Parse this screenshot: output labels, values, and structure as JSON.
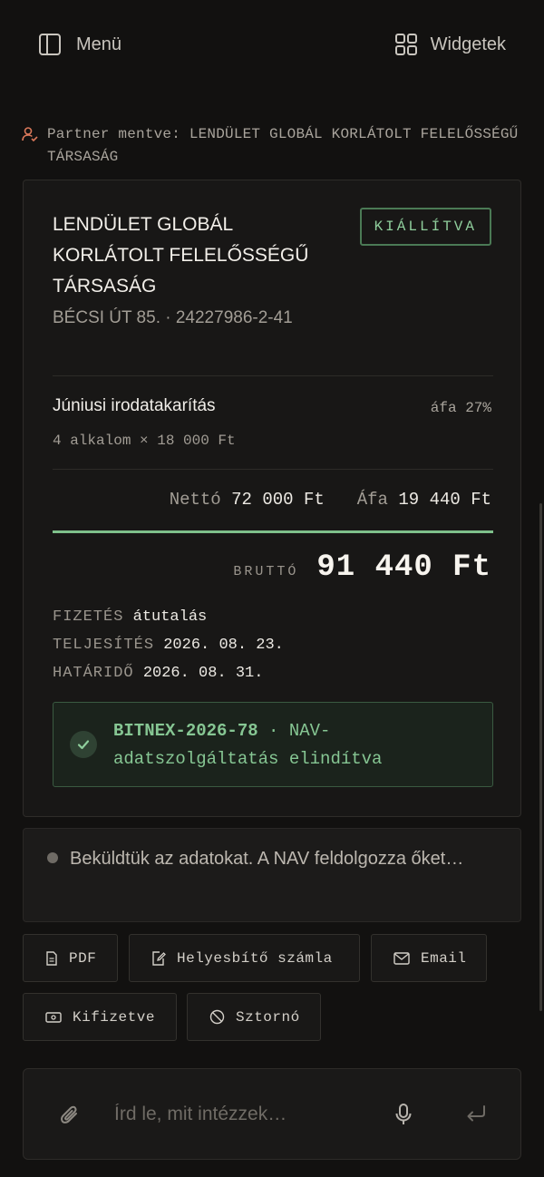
{
  "header": {
    "menu_label": "Menü",
    "menu_icon": "sidebar-panel-icon",
    "widgets_label": "Widgetek",
    "widgets_icon": "grid-icon"
  },
  "partner_notice": {
    "icon": "user-check-icon",
    "text": "Partner mentve: LENDÜLET GLOBÁL KORLÁTOLT FELELŐSSÉGŰ TÁRSASÁG"
  },
  "invoice": {
    "partner_name": "LENDÜLET GLOBÁL KORLÁTOLT FELELŐSSÉGŰ TÁRSASÁG",
    "partner_address": "BÉCSI ÚT 85. · 24227986-2-41",
    "status": "KIÁLLÍTVA",
    "item": {
      "name": "Júniusi irodatakarítás",
      "vat": "áfa 27%",
      "quantity": "4 alkalom × 18 000 Ft"
    },
    "net_label": "Nettó",
    "net_value": "72 000 Ft",
    "vat_label": "Áfa",
    "vat_value": "19 440 Ft",
    "gross_label": "BRUTTÓ",
    "gross_value": "91 440 Ft",
    "payment_label": "FIZETÉS",
    "payment_value": "átutalás",
    "fulfilment_label": "TELJESÍTÉS",
    "fulfilment_value": "2026. 08. 23.",
    "due_label": "HATÁRIDŐ",
    "due_value": "2026. 08. 31.",
    "nav": {
      "invoice_number": "BITNEX-2026-78",
      "message": " · NAV-adatszolgáltatás elindítva",
      "icon": "check-circle-icon"
    }
  },
  "status_message": "Beküldtük az adatokat. A NAV feldolgozza őket…",
  "actions": [
    {
      "label": "PDF",
      "icon": "document-icon"
    },
    {
      "label": "Helyesbítő számla",
      "icon": "edit-document-icon"
    },
    {
      "label": "Email",
      "icon": "mail-icon"
    },
    {
      "label": "Kifizetve",
      "icon": "banknote-icon"
    },
    {
      "label": "Sztornó",
      "icon": "cancel-circle-icon"
    }
  ],
  "composer": {
    "placeholder": "Írd le, mit intézzek…",
    "attach_icon": "paperclip-icon",
    "mic_icon": "microphone-icon",
    "send_icon": "enter-icon"
  },
  "colors": {
    "background": "#121110",
    "accent_green": "#7ec08b",
    "notice_icon": "#d9785a"
  }
}
